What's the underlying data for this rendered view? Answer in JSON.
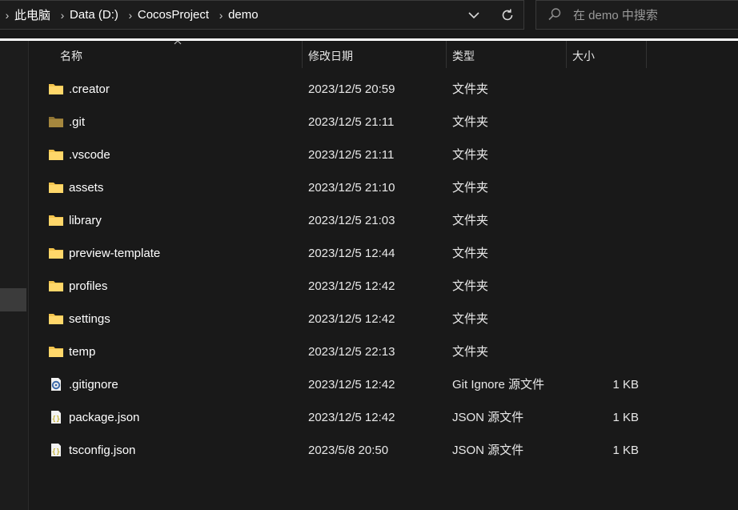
{
  "breadcrumb": [
    "此电脑",
    "Data (D:)",
    "CocosProject",
    "demo"
  ],
  "search": {
    "placeholder": "在 demo 中搜索"
  },
  "columns": {
    "name": "名称",
    "date": "修改日期",
    "type": "类型",
    "size": "大小"
  },
  "files": [
    {
      "name": ".creator",
      "date": "2023/12/5 20:59",
      "type": "文件夹",
      "size": "",
      "icon": "folder-icon"
    },
    {
      "name": ".git",
      "date": "2023/12/5 21:11",
      "type": "文件夹",
      "size": "",
      "icon": "folder-hidden-icon"
    },
    {
      "name": ".vscode",
      "date": "2023/12/5 21:11",
      "type": "文件夹",
      "size": "",
      "icon": "folder-icon"
    },
    {
      "name": "assets",
      "date": "2023/12/5 21:10",
      "type": "文件夹",
      "size": "",
      "icon": "folder-icon"
    },
    {
      "name": "library",
      "date": "2023/12/5 21:03",
      "type": "文件夹",
      "size": "",
      "icon": "folder-icon"
    },
    {
      "name": "preview-template",
      "date": "2023/12/5 12:44",
      "type": "文件夹",
      "size": "",
      "icon": "folder-icon"
    },
    {
      "name": "profiles",
      "date": "2023/12/5 12:42",
      "type": "文件夹",
      "size": "",
      "icon": "folder-icon"
    },
    {
      "name": "settings",
      "date": "2023/12/5 12:42",
      "type": "文件夹",
      "size": "",
      "icon": "folder-icon"
    },
    {
      "name": "temp",
      "date": "2023/12/5 22:13",
      "type": "文件夹",
      "size": "",
      "icon": "folder-icon"
    },
    {
      "name": ".gitignore",
      "date": "2023/12/5 12:42",
      "type": "Git Ignore 源文件",
      "size": "1 KB",
      "icon": "settings-file-icon"
    },
    {
      "name": "package.json",
      "date": "2023/12/5 12:42",
      "type": "JSON 源文件",
      "size": "1 KB",
      "icon": "json-file-icon"
    },
    {
      "name": "tsconfig.json",
      "date": "2023/5/8 20:50",
      "type": "JSON 源文件",
      "size": "1 KB",
      "icon": "json-file-icon"
    }
  ],
  "colors": {
    "background": "#191919",
    "folder": "#f3c34c",
    "folder_hidden": "#8f7433",
    "text": "#ffffff",
    "muted": "#9a9a9a"
  }
}
